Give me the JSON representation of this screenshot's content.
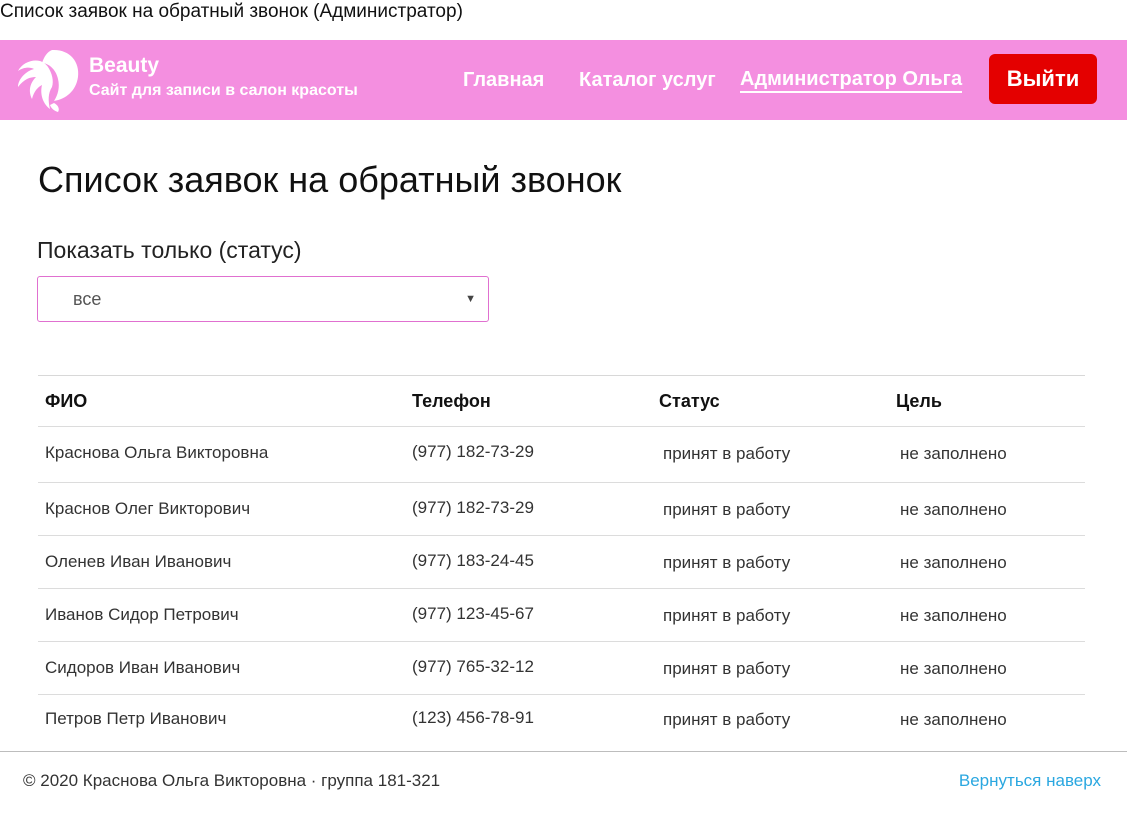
{
  "document": {
    "title": "Список заявок на обратный звонок (Администратор)"
  },
  "header": {
    "brand_name": "Beauty",
    "brand_tagline": "Сайт для записи в салон красоты",
    "logo_icon": "woman-profile-icon",
    "nav": {
      "home": "Главная",
      "catalog": "Каталог услуг",
      "user": "Администратор Ольга"
    },
    "logout_label": "Выйти",
    "colors": {
      "background": "#f48fe0",
      "logout": "#e40000"
    }
  },
  "main": {
    "heading": "Список заявок на обратный звонок",
    "filter": {
      "label": "Показать только (статус)",
      "selected": "все"
    },
    "table": {
      "columns": [
        "ФИО",
        "Телефон",
        "Статус",
        "Цель"
      ],
      "rows": [
        [
          "Краснова Ольга Викторовна",
          "(977) 182-73-29",
          "принят в работу",
          "не заполнено"
        ],
        [
          "Краснов Олег Викторович",
          "(977) 182-73-29",
          "принят в работу",
          "не заполнено"
        ],
        [
          "Оленев Иван Иванович",
          "(977) 183-24-45",
          "принят в работу",
          "не заполнено"
        ],
        [
          "Иванов Сидор Петрович",
          "(977) 123-45-67",
          "принят в работу",
          "не заполнено"
        ],
        [
          "Сидоров Иван Иванович",
          "(977) 765-32-12",
          "принят в работу",
          "не заполнено"
        ],
        [
          "Петров Петр Иванович",
          "(123) 456-78-91",
          "принят в работу",
          "не заполнено"
        ]
      ]
    }
  },
  "footer": {
    "copyright": "© 2020 Краснова Ольга Викторовна · группа 181-321",
    "back_to_top": "Вернуться наверх",
    "link_color": "#2aa7e0"
  }
}
